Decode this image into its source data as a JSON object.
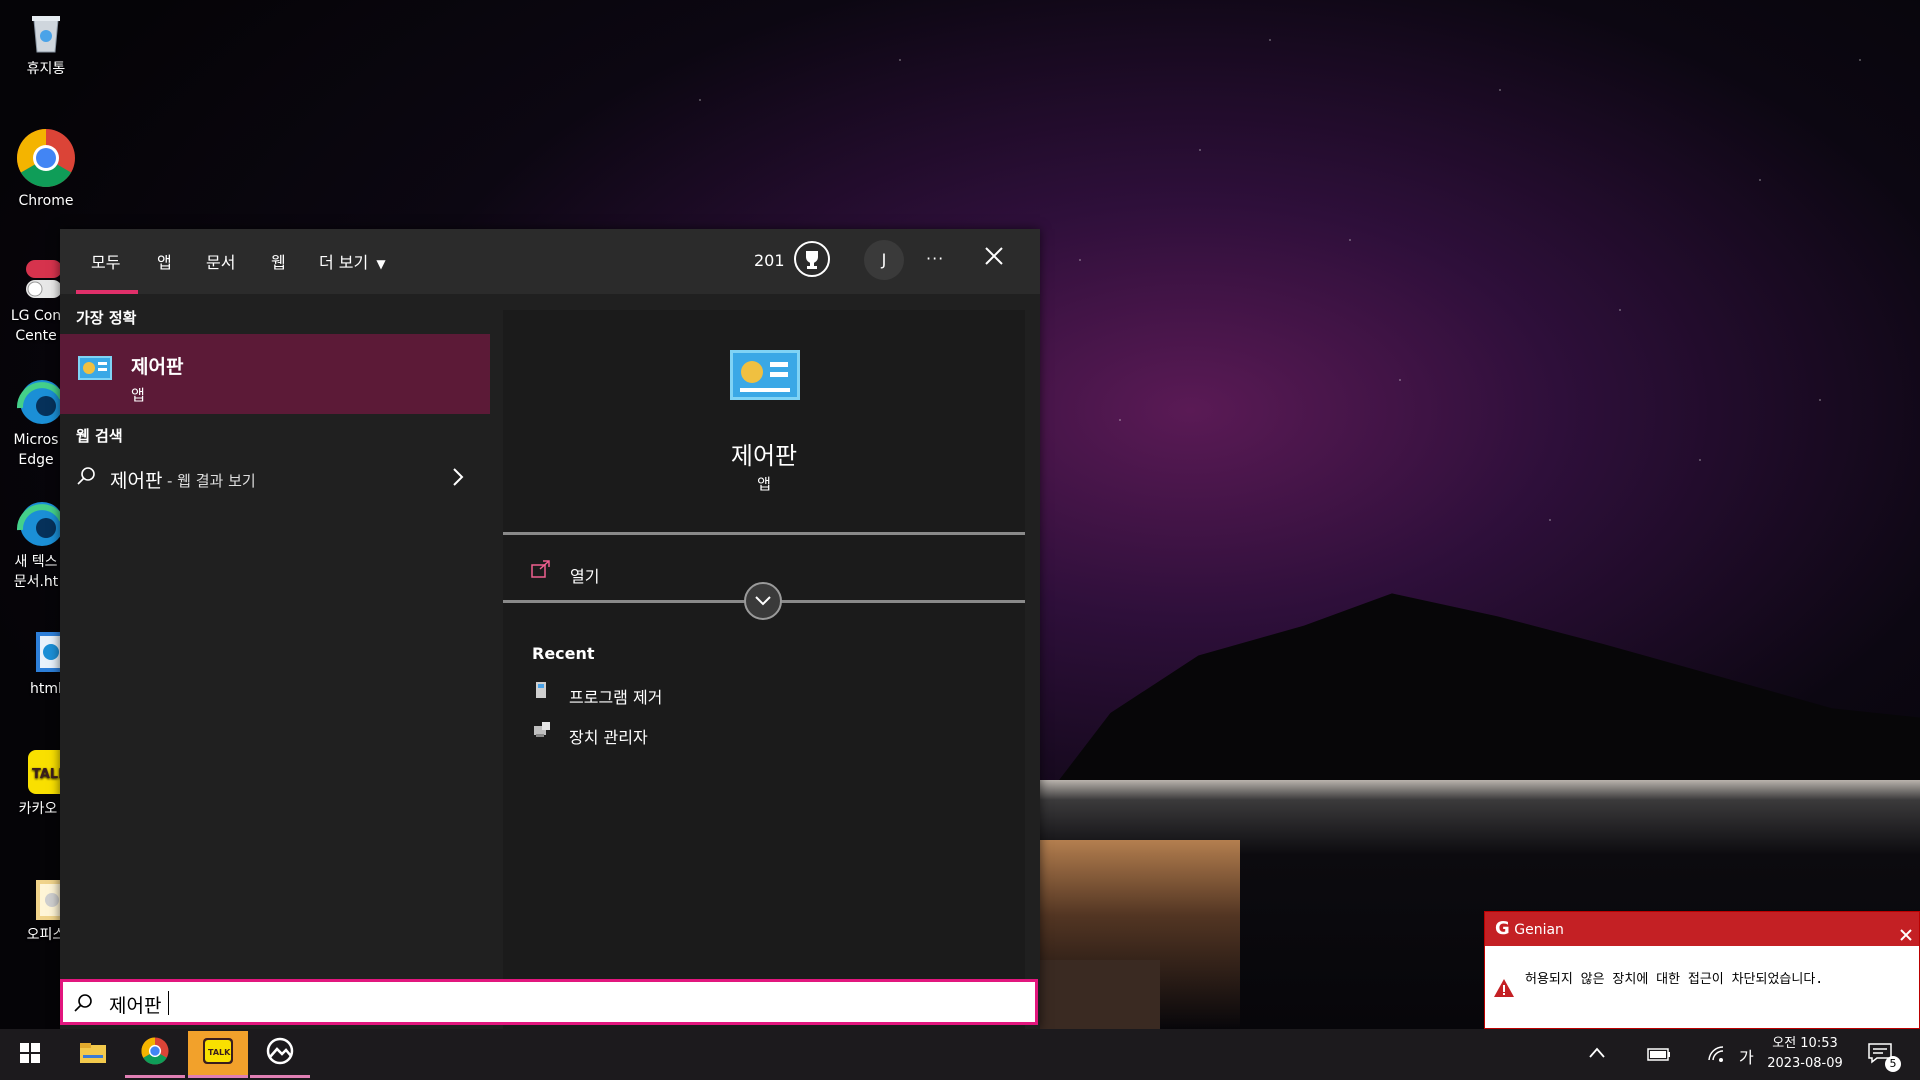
{
  "desktop": {
    "icons": [
      {
        "label": "휴지통"
      },
      {
        "label": "Chrome"
      },
      {
        "label": "LG Con Cente"
      },
      {
        "label": "Micros Edge"
      },
      {
        "label": "새 텍스 문서.ht"
      },
      {
        "label": "html"
      },
      {
        "label": "카카오"
      },
      {
        "label": "오피스"
      }
    ]
  },
  "search": {
    "tabs": [
      "모두",
      "앱",
      "문서",
      "웹",
      "더 보기"
    ],
    "points": "201",
    "avatar_initial": "J",
    "more_label": "···",
    "best_match_label": "가장 정확",
    "best_match": {
      "title": "제어판",
      "subtitle": "앱"
    },
    "web_search_label": "웹 검색",
    "web_result": {
      "query": "제어판",
      "suffix": " - 웹 결과 보기"
    },
    "preview": {
      "title": "제어판",
      "subtitle": "앱",
      "open_label": "열기"
    },
    "recent_label": "Recent",
    "recent_items": [
      "프로그램 제거",
      "장치 관리자"
    ],
    "input_value": "제어판",
    "accent_color": "#e2167e"
  },
  "genian": {
    "brand": "Genian",
    "message": "허용되지 않은 장치에 대한 접근이 차단되었습니다."
  },
  "taskbar": {
    "time": "오전 10:53",
    "date": "2023-08-09",
    "ime": "가",
    "notification_count": "5"
  }
}
